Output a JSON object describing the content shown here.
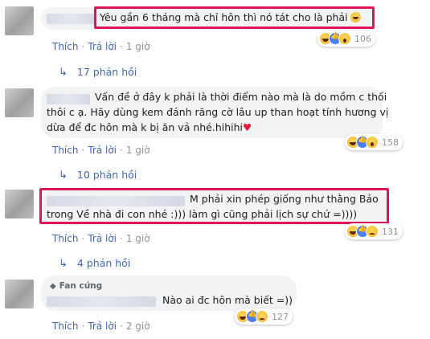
{
  "comments": [
    {
      "text": "Yêu gần 6 tháng mà chỉ hôn thì nó tát cho là phải",
      "reactions": [
        "haha-icon",
        "like-icon",
        "wow-icon"
      ],
      "reaction_count": "106",
      "actions": {
        "like": "Thích",
        "reply": "Trả lời",
        "time": "1 giờ"
      },
      "replies": "17 phản hồi"
    },
    {
      "text_line1": "Vấn đề ở đây k phải là thời điểm nào mà là do mồm c thối",
      "text_line2": "thôi c ạ. Hãy dùng kem đánh răng cờ lâu up than hoạt tính hương vị",
      "text_line3": "dừa để đc hôn mà k bị ăn vả nhé.hihihi",
      "reactions": [
        "haha-icon",
        "like-icon",
        "wow-icon"
      ],
      "reaction_count": "158",
      "actions": {
        "like": "Thích",
        "reply": "Trả lời",
        "time": "1 giờ"
      },
      "replies": "10 phản hồi"
    },
    {
      "text_line1": "M phải xin phép giống như thằng Bảo",
      "text_line2": "trong Về nhà đi con nhé :))) làm gì cũng phải lịch sự chứ =))))",
      "reactions": [
        "haha-icon",
        "like-icon",
        "sad-icon"
      ],
      "reaction_count": "131",
      "actions": {
        "like": "Thích",
        "reply": "Trả lời",
        "time": "1 giờ"
      },
      "replies": "4 phản hồi"
    },
    {
      "badge": "Fan cứng",
      "text": "Nào ai đc hôn mà biết =))",
      "reactions": [
        "haha-icon",
        "like-icon",
        "sad-icon"
      ],
      "reaction_count": "127",
      "actions": {
        "like": "Thích",
        "reply": "Trả lời",
        "time": "2 giờ"
      }
    }
  ],
  "colors": {
    "highlight": "#e0145a",
    "link": "#4267b2",
    "bubble": "#f2f3f5"
  }
}
